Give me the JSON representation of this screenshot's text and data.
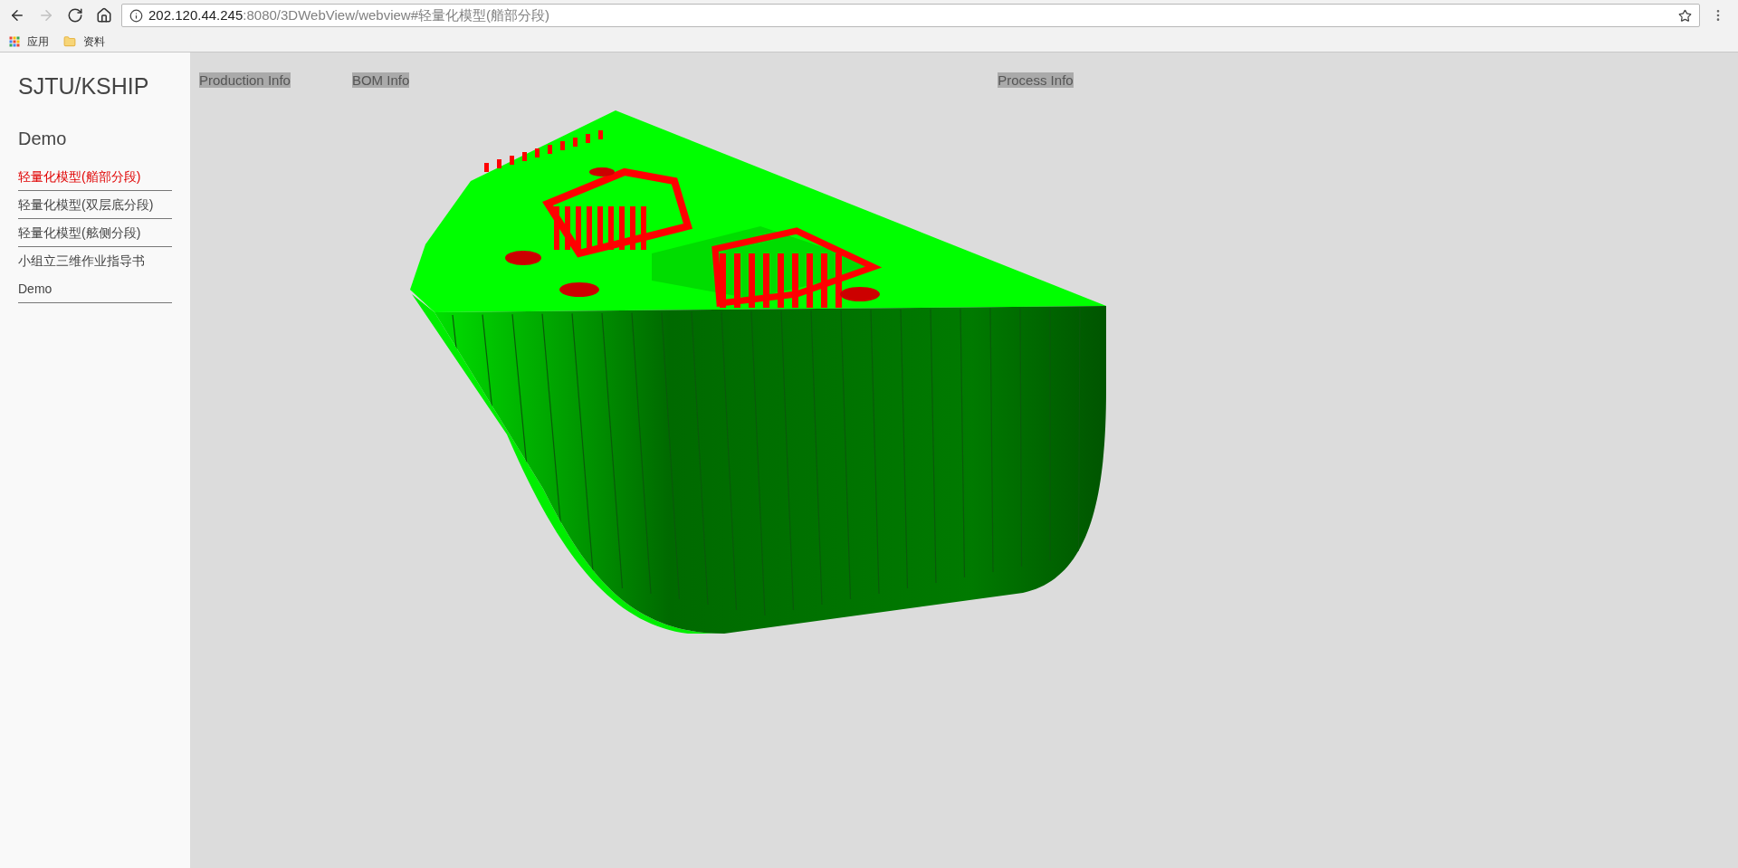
{
  "browser": {
    "nav_buttons": [
      {
        "kind": "back",
        "disabled": false
      },
      {
        "kind": "forward",
        "disabled": true
      },
      {
        "kind": "reload",
        "disabled": false
      },
      {
        "kind": "home",
        "disabled": false
      }
    ],
    "address": {
      "host": "202.120.44.245",
      "path": ":8080/3DWebView/webview#轻量化模型(艏部分段)"
    },
    "bookmarks": [
      {
        "kind": "apps",
        "label": "应用"
      },
      {
        "kind": "folder",
        "label": "资料"
      }
    ]
  },
  "sidebar": {
    "brand": "SJTU/KSHIP",
    "section": "Demo",
    "items": [
      {
        "label": "轻量化模型(艏部分段)",
        "selected": true,
        "divider": true
      },
      {
        "label": "轻量化模型(双层底分段)",
        "selected": false,
        "divider": true
      },
      {
        "label": "轻量化模型(舷侧分段)",
        "selected": false,
        "divider": true
      },
      {
        "label": "小组立三维作业指导书",
        "selected": false,
        "divider": false
      },
      {
        "label": "Demo",
        "selected": false,
        "divider": true
      }
    ]
  },
  "viewer": {
    "info_tabs": [
      "Production Info",
      "BOM Info",
      "Process Info"
    ]
  }
}
